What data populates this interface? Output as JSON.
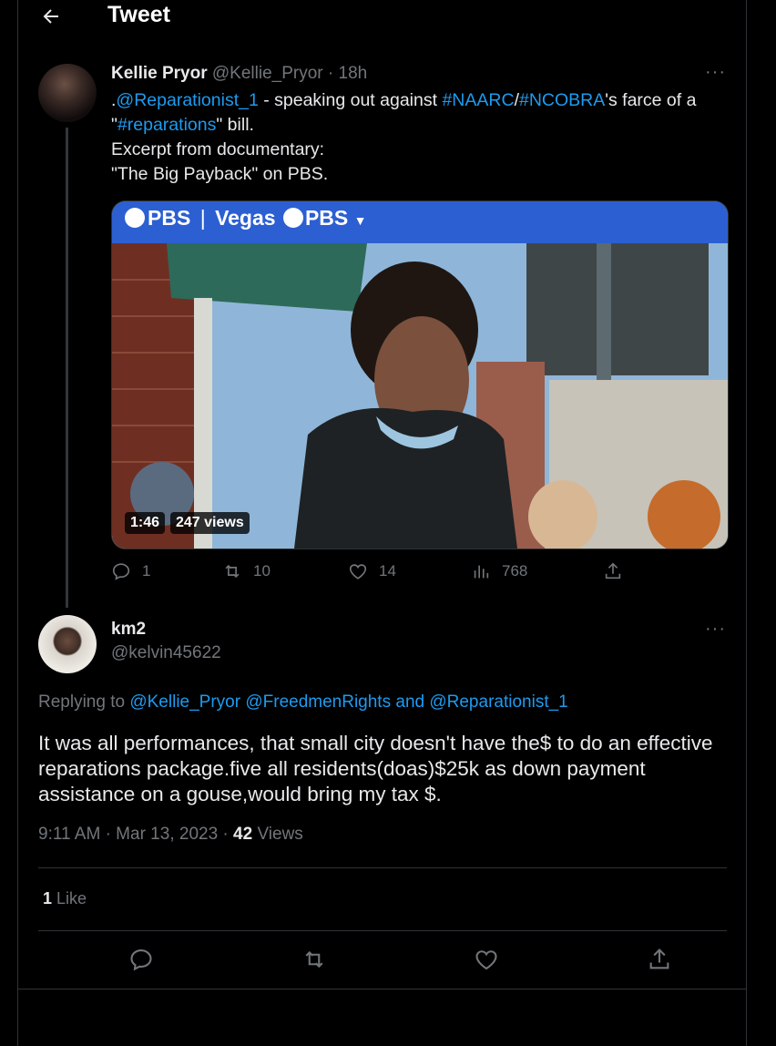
{
  "header": {
    "title": "Tweet"
  },
  "original_tweet": {
    "author_name": "Kellie Pryor",
    "author_handle": "@Kellie_Pryor",
    "time": "18h",
    "text": {
      "mention_prefix": ".",
      "mention": "@Reparationist_1",
      "part1": " - speaking out against ",
      "hashtag1": "#NAARC",
      "slash": "/",
      "hashtag2": "#NCOBRA",
      "part2": "'s farce of a \"",
      "hashtag3": "#reparations",
      "part3": "\" bill.",
      "line2": "Excerpt from documentary:",
      "line3": "\"The Big Payback\" on PBS."
    },
    "video": {
      "brand_left": "PBS",
      "brand_divider": "|",
      "brand_middle": "Vegas",
      "brand_right": "PBS",
      "duration": "1:46",
      "views": "247 views"
    },
    "actions": {
      "replies": "1",
      "retweets": "10",
      "likes": "14",
      "views": "768"
    }
  },
  "reply_tweet": {
    "author_name": "km2",
    "author_handle": "@kelvin45622",
    "replying_to_label": "Replying to",
    "replying_to_1": "@Kellie_Pryor",
    "replying_to_2": "@FreedmenRights",
    "replying_to_and": "and",
    "replying_to_3": "@Reparationist_1",
    "text": "It was all performances, that small city doesn't have the$ to do an effective reparations package.five all residents(doas)$25k as down payment assistance on a gouse,would bring my tax $.",
    "timestamp": "9:11 AM · Mar 13, 2023 ·",
    "views_count": "42",
    "views_label": "Views",
    "likes_count": "1",
    "likes_label": "Like"
  },
  "colors": {
    "background": "#000000",
    "text": "#e7e9ea",
    "muted": "#71767b",
    "link": "#1d9bf0",
    "border": "#2f3336"
  },
  "icons": [
    "back-arrow-icon",
    "more-icon",
    "reply-icon",
    "retweet-icon",
    "like-icon",
    "views-icon",
    "share-icon"
  ]
}
